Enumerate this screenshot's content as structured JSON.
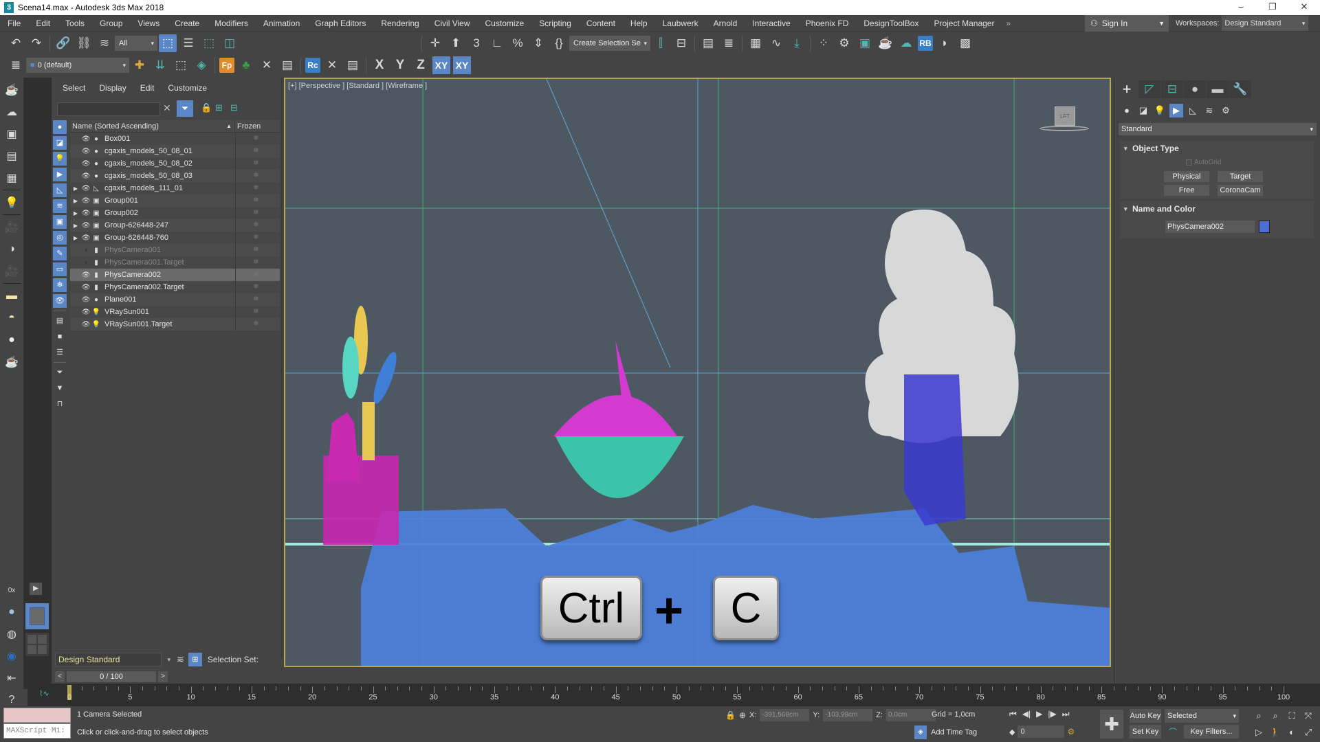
{
  "window": {
    "title": "Scena14.max - Autodesk 3ds Max 2018",
    "app_icon": "3",
    "controls": [
      "–",
      "❐",
      "✕"
    ]
  },
  "menubar": {
    "items": [
      "File",
      "Edit",
      "Tools",
      "Group",
      "Views",
      "Create",
      "Modifiers",
      "Animation",
      "Graph Editors",
      "Rendering",
      "Civil View",
      "Customize",
      "Scripting",
      "Content",
      "Help",
      "Laubwerk",
      "Arnold",
      "Interactive",
      "Phoenix FD",
      "DesignToolBox",
      "Project Manager"
    ],
    "overflow": "»",
    "sign_in": "Sign In",
    "workspaces_label": "Workspaces:",
    "workspaces_value": "Design Standard"
  },
  "toolbar1": {
    "selection_filter": "All",
    "named_selection": "Create Selection Se"
  },
  "toolbar2": {
    "layer": "0 (default)",
    "fp_label": "Fp",
    "rc_label": "Rc",
    "rb_label": "RB",
    "axis": [
      "X",
      "Y",
      "Z",
      "XY",
      "XY"
    ]
  },
  "scene_explorer": {
    "menu": [
      "Select",
      "Display",
      "Edit",
      "Customize"
    ],
    "search_value": "",
    "columns": {
      "name": "Name (Sorted Ascending)",
      "frozen": "Frozen"
    },
    "rows": [
      {
        "name": "Box001",
        "type": "geometry",
        "expandable": false,
        "visible": true,
        "selected": false
      },
      {
        "name": "cgaxis_models_50_08_01",
        "type": "geometry",
        "expandable": false,
        "visible": true,
        "selected": false
      },
      {
        "name": "cgaxis_models_50_08_02",
        "type": "geometry",
        "expandable": false,
        "visible": true,
        "selected": false
      },
      {
        "name": "cgaxis_models_50_08_03",
        "type": "geometry",
        "expandable": false,
        "visible": true,
        "selected": false
      },
      {
        "name": "cgaxis_models_111_01",
        "type": "helper",
        "expandable": true,
        "visible": true,
        "selected": false
      },
      {
        "name": "Group001",
        "type": "group",
        "expandable": true,
        "visible": true,
        "selected": false
      },
      {
        "name": "Group002",
        "type": "group",
        "expandable": true,
        "visible": true,
        "selected": false
      },
      {
        "name": "Group-626448-247",
        "type": "group",
        "expandable": true,
        "visible": true,
        "selected": false
      },
      {
        "name": "Group-626448-760",
        "type": "group",
        "expandable": true,
        "visible": true,
        "selected": false
      },
      {
        "name": "PhysCamera001",
        "type": "camera",
        "expandable": false,
        "visible": false,
        "selected": false
      },
      {
        "name": "PhysCamera001.Target",
        "type": "camera",
        "expandable": false,
        "visible": false,
        "selected": false
      },
      {
        "name": "PhysCamera002",
        "type": "camera",
        "expandable": false,
        "visible": true,
        "selected": true
      },
      {
        "name": "PhysCamera002.Target",
        "type": "camera",
        "expandable": false,
        "visible": true,
        "selected": false
      },
      {
        "name": "Plane001",
        "type": "geometry",
        "expandable": false,
        "visible": true,
        "selected": false
      },
      {
        "name": "VRaySun001",
        "type": "light",
        "expandable": false,
        "visible": true,
        "selected": false
      },
      {
        "name": "VRaySun001.Target",
        "type": "light",
        "expandable": false,
        "visible": true,
        "selected": false
      }
    ],
    "layer_explorer": "Design Standard",
    "selection_set_label": "Selection Set:"
  },
  "viewport": {
    "label": "[+] [Perspective ] [Standard ] [Wireframe ]",
    "viewcube_face": "LFT",
    "overlay_keys": {
      "key1": "Ctrl",
      "plus": "+",
      "key2": "C"
    }
  },
  "command_panel": {
    "tabs": [
      "create",
      "modify",
      "hierarchy",
      "motion",
      "display",
      "utilities"
    ],
    "category": "Standard",
    "object_type": {
      "title": "Object Type",
      "autogrid": "AutoGrid",
      "buttons": [
        "Physical",
        "Target",
        "Free",
        "CoronaCam"
      ]
    },
    "name_and_color": {
      "title": "Name and Color",
      "name": "PhysCamera002",
      "color": "#4d6fd4"
    }
  },
  "timeline": {
    "slider_label": "0 / 100",
    "current_frame": 0,
    "start": 0,
    "end": 100,
    "labels": [
      "0",
      "5",
      "10",
      "15",
      "20",
      "25",
      "30",
      "35",
      "40",
      "45",
      "50",
      "55",
      "60",
      "65",
      "70",
      "75",
      "80",
      "85",
      "90",
      "95",
      "100"
    ]
  },
  "status": {
    "maxscript_placeholder": "MAXScript Mi:",
    "line1": "1 Camera Selected",
    "line2": "Click or click-and-drag to select objects",
    "x_label": "X:",
    "x": "-391,568cm",
    "y_label": "Y:",
    "y": "-103,98cm",
    "z_label": "Z:",
    "z": "0,0cm",
    "grid": "Grid = 1,0cm",
    "add_time_tag": "Add Time Tag",
    "frame_value": "0",
    "auto_key": "Auto Key",
    "set_key": "Set Key",
    "key_mode": "Selected",
    "key_filters": "Key Filters..."
  },
  "colors": {
    "accent": "#5b87c6",
    "viewport_bg": "#4d5863",
    "viewport_border": "#b8a84c",
    "object_color": "#4d6fd4"
  }
}
